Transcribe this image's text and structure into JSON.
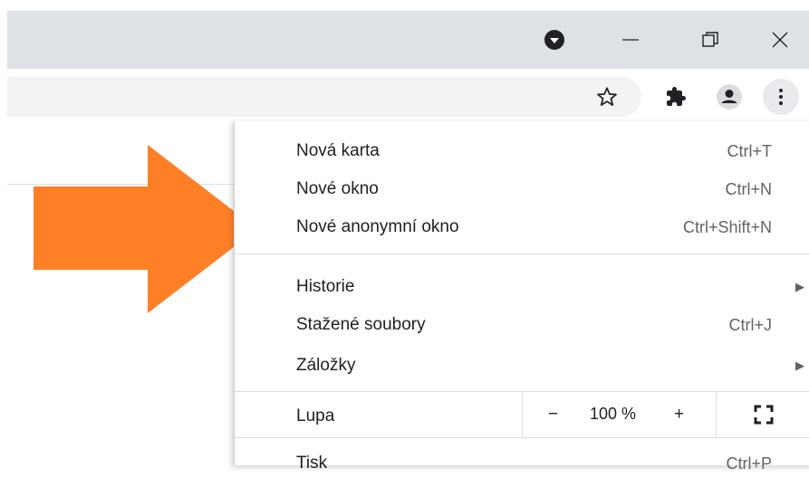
{
  "titlebar": {
    "profile_icon": "chevron-down-circle-icon",
    "minimize_icon": "minimize-icon",
    "restore_icon": "restore-icon",
    "close_icon": "close-icon"
  },
  "toolbar": {
    "star_icon": "star-icon",
    "extensions_icon": "puzzle-icon",
    "profile_icon": "person-icon",
    "menu_icon": "more-vertical-icon"
  },
  "colors": {
    "arrow": "#ff7f27"
  },
  "menu": {
    "items": [
      {
        "label": "Nová karta",
        "shortcut": "Ctrl+T"
      },
      {
        "label": "Nové okno",
        "shortcut": "Ctrl+N"
      },
      {
        "label": "Nové anonymní okno",
        "shortcut": "Ctrl+Shift+N"
      },
      {
        "label": "Historie",
        "submenu": "▶"
      },
      {
        "label": "Stažené soubory",
        "shortcut": "Ctrl+J"
      },
      {
        "label": "Záložky",
        "submenu": "▶"
      }
    ],
    "zoom": {
      "label": "Lupa",
      "minus": "−",
      "value": "100 %",
      "plus": "+",
      "fullscreen_icon": "fullscreen-icon"
    },
    "cutoff": {
      "label": "Tisk",
      "shortcut": "Ctrl+P"
    }
  }
}
